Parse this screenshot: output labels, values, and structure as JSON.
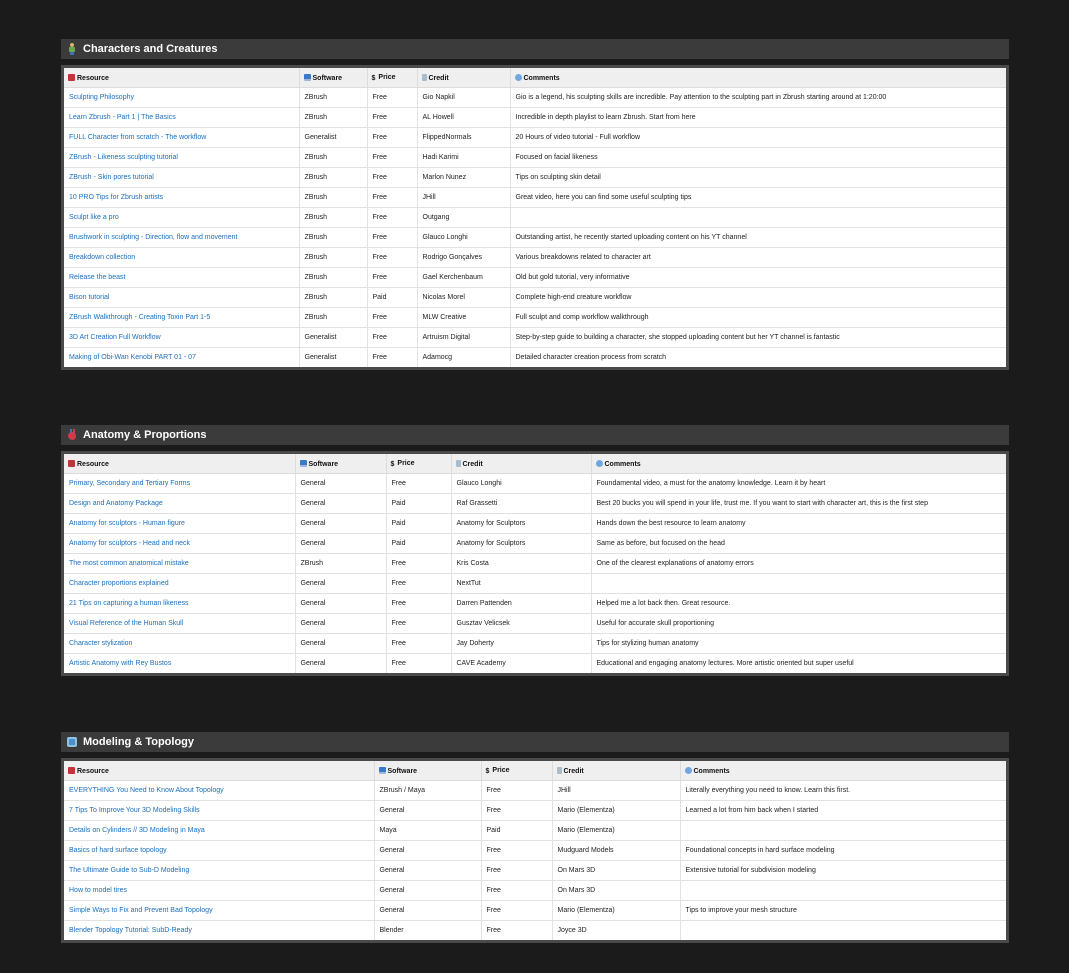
{
  "sections": [
    {
      "title": "Characters and Creatures",
      "icon": "person-icon",
      "headers": [
        "Resource",
        "Software",
        "Price",
        "Credit",
        "Comments"
      ],
      "rows": [
        [
          "Sculpting Philosophy",
          "ZBrush",
          "Free",
          "Gio Napkil",
          "Gio is a legend, his sculpting skills are incredible. Pay attention to the sculpting part in Zbrush starting around at 1:20:00"
        ],
        [
          "Learn Zbrush - Part 1 | The Basics",
          "ZBrush",
          "Free",
          "AL Howell",
          "Incredible in depth playlist to learn Zbrush. Start from here"
        ],
        [
          "FULL Character from scratch - The workflow",
          "Generalist",
          "Free",
          "FlippedNormals",
          "20 Hours of video tutorial - Full workflow"
        ],
        [
          "ZBrush - Likeness sculpting tutorial",
          "ZBrush",
          "Free",
          "Hadi Karimi",
          "Focused on facial likeness"
        ],
        [
          "ZBrush - Skin pores tutorial",
          "ZBrush",
          "Free",
          "Marlon Nunez",
          "Tips on sculpting skin detail"
        ],
        [
          "10 PRO Tips for Zbrush artists",
          "ZBrush",
          "Free",
          "JHill",
          "Great video, here you can find some useful sculpting tips"
        ],
        [
          "Sculpt like a pro",
          "ZBrush",
          "Free",
          "Outgang",
          ""
        ],
        [
          "Brushwork in sculpting - Direction, flow and movement",
          "ZBrush",
          "Free",
          "Glauco Longhi",
          "Outstanding artist, he recently started uploading content on his YT channel"
        ],
        [
          "Breakdown collection",
          "ZBrush",
          "Free",
          "Rodrigo Gonçalves",
          "Various breakdowns related to character art"
        ],
        [
          "Release the beast",
          "ZBrush",
          "Free",
          "Gael Kerchenbaum",
          "Old but gold tutorial, very informative"
        ],
        [
          "Bison tutorial",
          "ZBrush",
          "Paid",
          "Nicolas Morel",
          "Complete high-end creature workflow"
        ],
        [
          "ZBrush Walkthrough - Creating Toxin Part 1-5",
          "ZBrush",
          "Free",
          "MLW Creative",
          "Full sculpt and comp workflow walkthrough"
        ],
        [
          "3D Art Creation Full Workflow",
          "Generalist",
          "Free",
          "Artruism Digital",
          "Step-by-step guide to building a character, she stopped uploading content but her YT channel is fantastic"
        ],
        [
          "Making of Obi-Wan Kenobi PART 01 - 07",
          "Generalist",
          "Free",
          "Adamocg",
          "Detailed character creation process from scratch"
        ]
      ]
    },
    {
      "title": "Anatomy & Proportions",
      "icon": "anatomical-heart-icon",
      "headers": [
        "Resource",
        "Software",
        "Price",
        "Credit",
        "Comments"
      ],
      "rows": [
        [
          "Primary, Secondary and Tertiary Forms",
          "General",
          "Free",
          "Glauco Longhi",
          "Foundamental video, a must for the anatomy knowledge. Learn it by heart"
        ],
        [
          "Design and Anatomy Package",
          "General",
          "Paid",
          "Raf Grassetti",
          "Best 20 bucks you will spend in your life, trust me. If you want to start with character art, this is the first step"
        ],
        [
          "Anatomy for sculptors - Human figure",
          "General",
          "Paid",
          "Anatomy for Sculptors",
          "Hands down the best resource to learn anatomy"
        ],
        [
          "Anatomy for sculptors - Head and neck",
          "General",
          "Paid",
          "Anatomy for Sculptors",
          "Same as before, but focused on the head"
        ],
        [
          "The most common anatomical mistake",
          "ZBrush",
          "Free",
          "Kris Costa",
          "One of the clearest explanations of anatomy errors"
        ],
        [
          "Character proportions explained",
          "General",
          "Free",
          "NextTut",
          ""
        ],
        [
          "21 Tips on capturing a human likeness",
          "General",
          "Free",
          "Darren Pattenden",
          "Helped me a lot back then. Great resource."
        ],
        [
          "Visual Reference of the Human Skull",
          "General",
          "Free",
          "Gusztav Velicsek",
          "Useful for accurate skull proportioning"
        ],
        [
          "Character stylization",
          "General",
          "Free",
          "Jay Doherty",
          "Tips for stylizing human anatomy"
        ],
        [
          "Artistic Anatomy with Rey Bustos",
          "General",
          "Free",
          "CAVE Academy",
          "Educational and engaging anatomy lectures. More artistic oriented but super useful"
        ]
      ]
    },
    {
      "title": "Modeling & Topology",
      "icon": "cube-icon",
      "headers": [
        "Resource",
        "Software",
        "Price",
        "Credit",
        "Comments"
      ],
      "rows": [
        [
          "EVERYTHING You Need to Know About Topology",
          "ZBrush / Maya",
          "Free",
          "JHill",
          "Literally everything you need to know. Learn this first."
        ],
        [
          "7 Tips To Improve Your 3D Modeling Skills",
          "General",
          "Free",
          "Mario (Elementza)",
          "Learned a lot from him back when I started"
        ],
        [
          "Details on Cylinders // 3D Modeling in Maya",
          "Maya",
          "Paid",
          "Mario (Elementza)",
          ""
        ],
        [
          "Basics of hard surface topology",
          "General",
          "Free",
          "Mudguard Models",
          "Foundational concepts in hard surface modeling"
        ],
        [
          "The Ultimate Guide to Sub-D Modeling",
          "General",
          "Free",
          "On Mars 3D",
          "Extensive tutorial for subdivision modeling"
        ],
        [
          "How to model tires",
          "General",
          "Free",
          "On Mars 3D",
          ""
        ],
        [
          "Simple Ways to Fix and Prevent Bad Topology",
          "General",
          "Free",
          "Mario (Elementza)",
          "Tips to improve your mesh structure"
        ],
        [
          "Blender Topology Tutorial: SubD-Ready",
          "Blender",
          "Free",
          "Joyce 3D",
          ""
        ]
      ]
    }
  ]
}
